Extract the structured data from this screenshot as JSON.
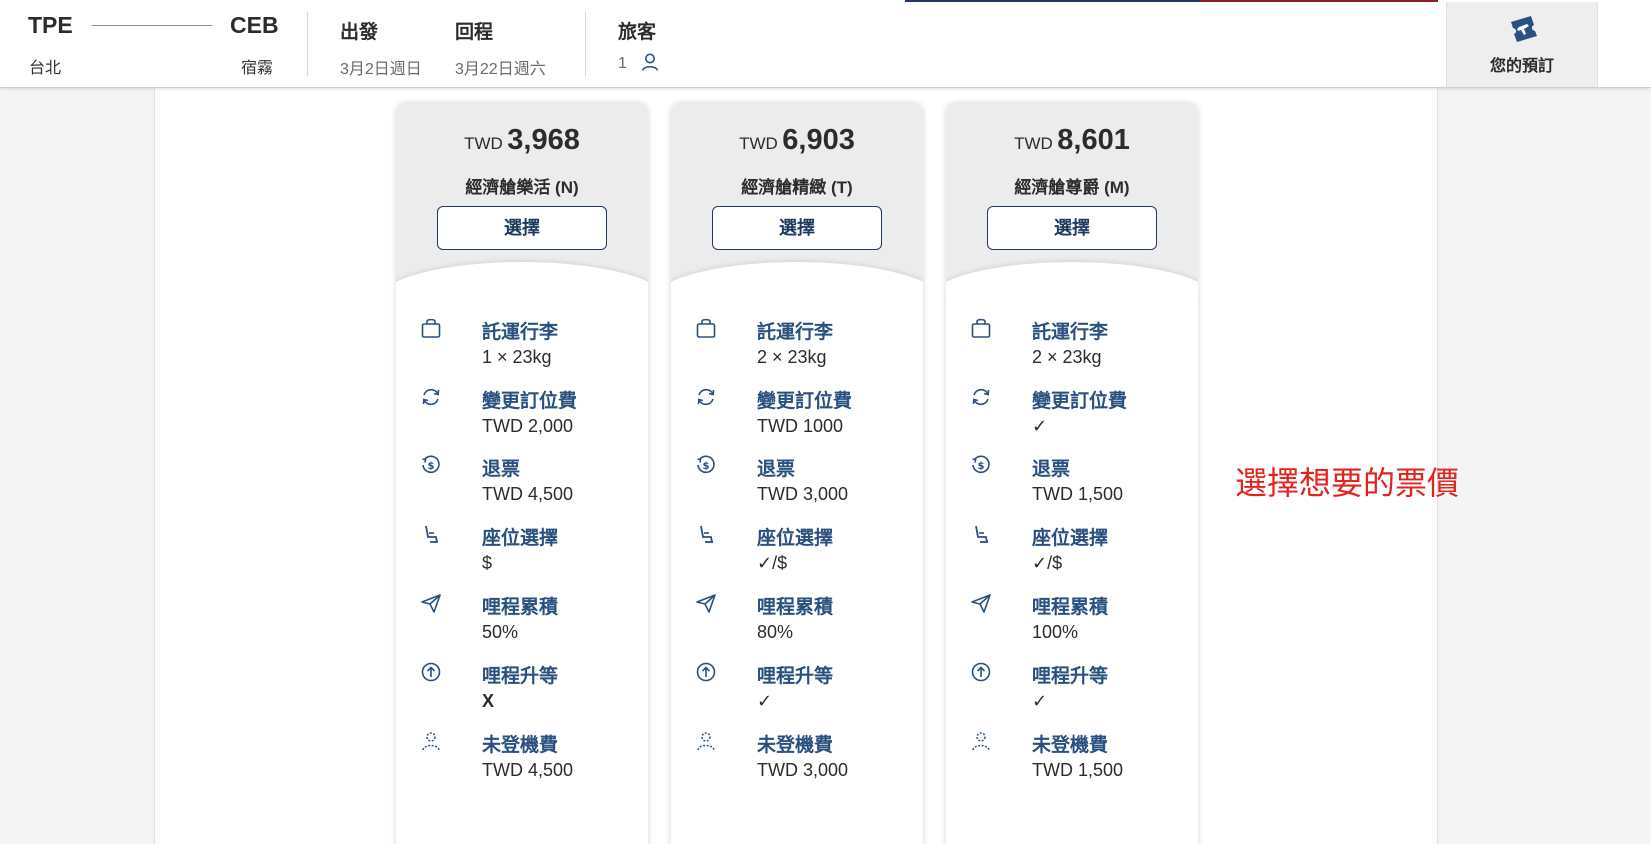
{
  "header": {
    "origin_code": "TPE",
    "origin_city": "台北",
    "destination_code": "CEB",
    "destination_city": "宿霧",
    "depart_label": "出發",
    "depart_date": "3月2日週日",
    "return_label": "回程",
    "return_date": "3月22日週六",
    "passengers_label": "旅客",
    "passengers_count": "1",
    "booking_label": "您的預訂"
  },
  "fares": [
    {
      "currency": "TWD",
      "price": "3,968",
      "name": "經濟艙樂活 (N)",
      "select_label": "選擇",
      "features": [
        {
          "icon": "baggage-icon",
          "title": "託運行李",
          "value": "1 × 23kg"
        },
        {
          "icon": "change-fee-icon",
          "title": "變更訂位費",
          "value": "TWD 2,000"
        },
        {
          "icon": "refund-icon",
          "title": "退票",
          "value": "TWD 4,500"
        },
        {
          "icon": "seat-icon",
          "title": "座位選擇",
          "value": "$"
        },
        {
          "icon": "plane-mileage-icon",
          "title": "哩程累積",
          "value": "50%"
        },
        {
          "icon": "upgrade-icon",
          "title": "哩程升等",
          "value": "X"
        },
        {
          "icon": "no-show-icon",
          "title": "未登機費",
          "value": "TWD 4,500"
        }
      ]
    },
    {
      "currency": "TWD",
      "price": "6,903",
      "name": "經濟艙精緻 (T)",
      "select_label": "選擇",
      "features": [
        {
          "icon": "baggage-icon",
          "title": "託運行李",
          "value": "2 × 23kg"
        },
        {
          "icon": "change-fee-icon",
          "title": "變更訂位費",
          "value": "TWD 1000"
        },
        {
          "icon": "refund-icon",
          "title": "退票",
          "value": "TWD 3,000"
        },
        {
          "icon": "seat-icon",
          "title": "座位選擇",
          "value": "✓/$"
        },
        {
          "icon": "plane-mileage-icon",
          "title": "哩程累積",
          "value": "80%"
        },
        {
          "icon": "upgrade-icon",
          "title": "哩程升等",
          "value": "✓"
        },
        {
          "icon": "no-show-icon",
          "title": "未登機費",
          "value": "TWD 3,000"
        }
      ]
    },
    {
      "currency": "TWD",
      "price": "8,601",
      "name": "經濟艙尊爵 (M)",
      "select_label": "選擇",
      "features": [
        {
          "icon": "baggage-icon",
          "title": "託運行李",
          "value": "2 × 23kg"
        },
        {
          "icon": "change-fee-icon",
          "title": "變更訂位費",
          "value": "✓"
        },
        {
          "icon": "refund-icon",
          "title": "退票",
          "value": "TWD 1,500"
        },
        {
          "icon": "seat-icon",
          "title": "座位選擇",
          "value": "✓/$"
        },
        {
          "icon": "plane-mileage-icon",
          "title": "哩程累積",
          "value": "100%"
        },
        {
          "icon": "upgrade-icon",
          "title": "哩程升等",
          "value": "✓"
        },
        {
          "icon": "no-show-icon",
          "title": "未登機費",
          "value": "TWD 1,500"
        }
      ]
    }
  ],
  "annotation": "選擇想要的票價",
  "colors": {
    "brand_navy": "#1f3a5c",
    "feature_title_blue": "#2a5080",
    "annotation_red": "#e3231e",
    "card_head_gray": "#ececec"
  }
}
